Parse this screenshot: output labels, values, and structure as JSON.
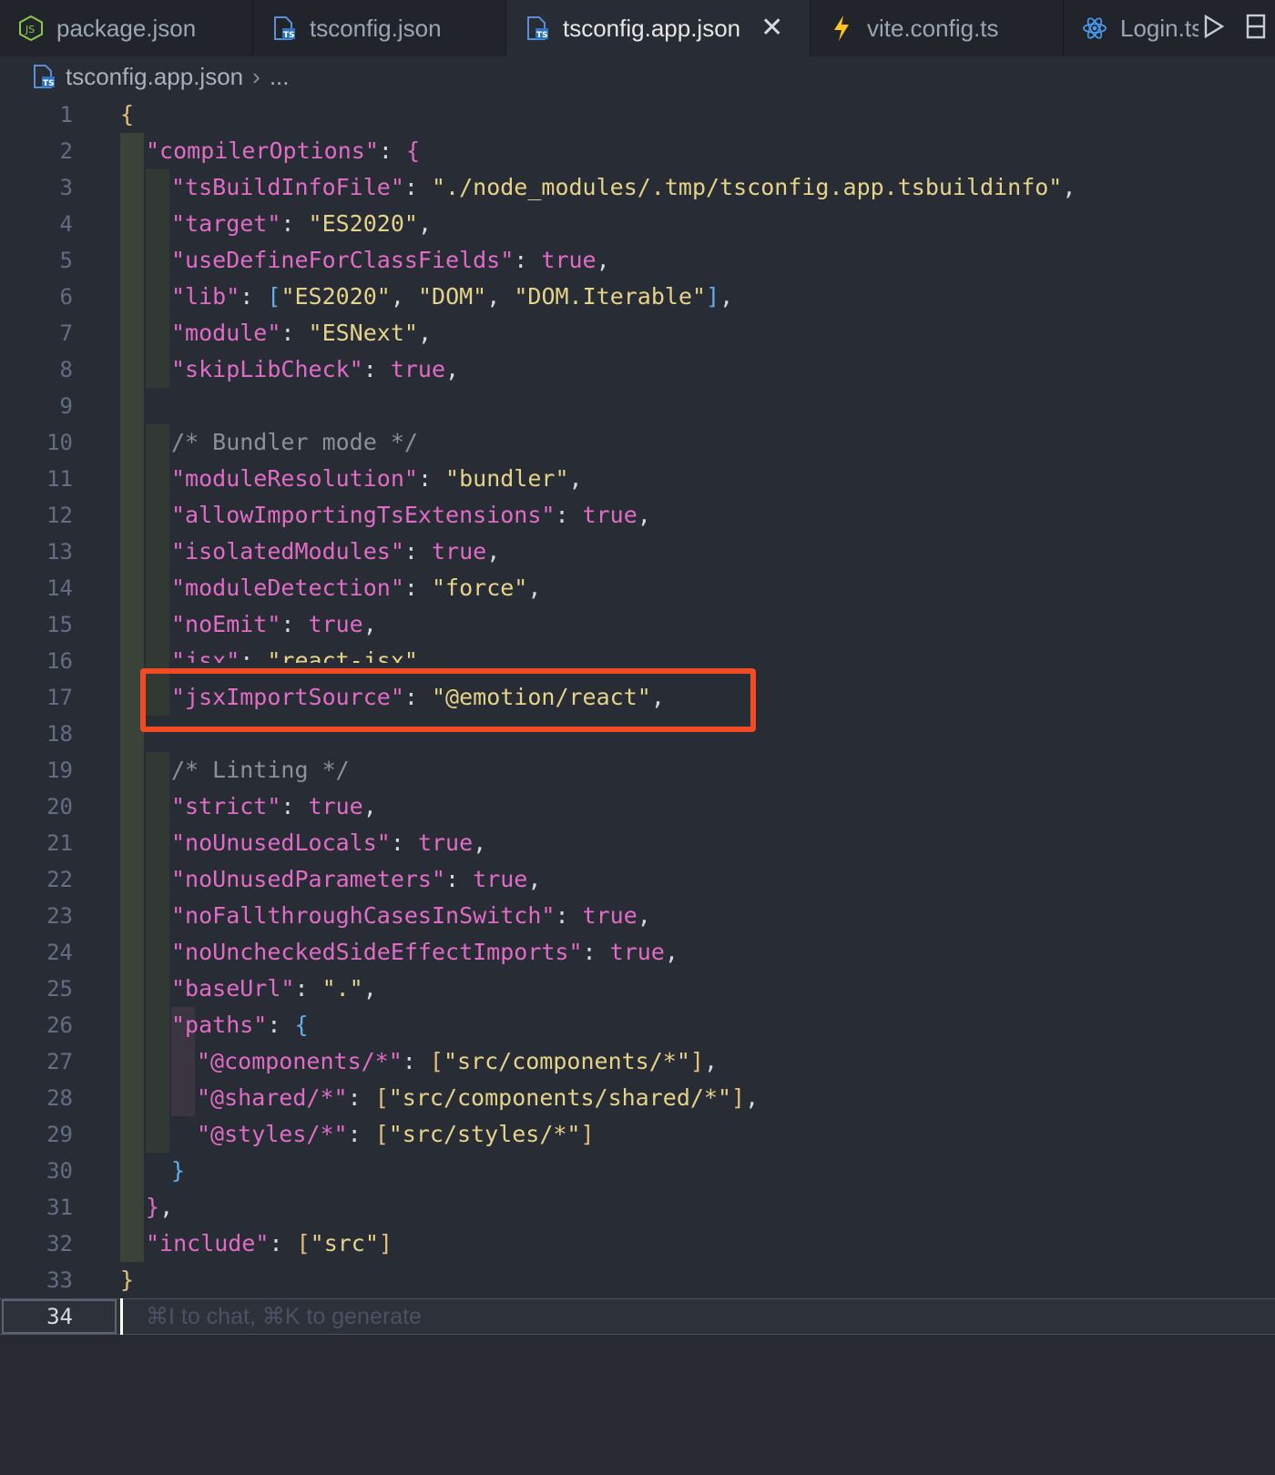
{
  "tabs": [
    {
      "label": "package.json",
      "icon": "nodejs-icon",
      "active": false
    },
    {
      "label": "tsconfig.json",
      "icon": "tsconfig-icon",
      "active": false
    },
    {
      "label": "tsconfig.app.json",
      "icon": "tsconfig-icon",
      "active": true
    },
    {
      "label": "vite.config.ts",
      "icon": "vite-icon",
      "active": false
    },
    {
      "label": "Login.ts",
      "icon": "react-icon",
      "active": false
    }
  ],
  "breadcrumb": {
    "file": "tsconfig.app.json",
    "rest": "..."
  },
  "editor": {
    "current_line": "34",
    "hint": "⌘I to chat, ⌘K to generate",
    "lines": [
      "1",
      "2",
      "3",
      "4",
      "5",
      "6",
      "7",
      "8",
      "9",
      "10",
      "11",
      "12",
      "13",
      "14",
      "15",
      "16",
      "17",
      "18",
      "19",
      "20",
      "21",
      "22",
      "23",
      "24",
      "25",
      "26",
      "27",
      "28",
      "29",
      "30",
      "31",
      "32",
      "33"
    ],
    "code": {
      "compilerOptions": "\"compilerOptions\"",
      "tsBuildInfoFile_k": "\"tsBuildInfoFile\"",
      "tsBuildInfoFile_v": "\"./node_modules/.tmp/tsconfig.app.tsbuildinfo\"",
      "target_k": "\"target\"",
      "target_v": "\"ES2020\"",
      "useDefine_k": "\"useDefineForClassFields\"",
      "true": "true",
      "lib_k": "\"lib\"",
      "lib_v1": "\"ES2020\"",
      "lib_v2": "\"DOM\"",
      "lib_v3": "\"DOM.Iterable\"",
      "module_k": "\"module\"",
      "module_v": "\"ESNext\"",
      "skipLib_k": "\"skipLibCheck\"",
      "comment_bundler": "/* Bundler mode */",
      "moduleRes_k": "\"moduleResolution\"",
      "moduleRes_v": "\"bundler\"",
      "allowTs_k": "\"allowImportingTsExtensions\"",
      "isolated_k": "\"isolatedModules\"",
      "moduleDet_k": "\"moduleDetection\"",
      "moduleDet_v": "\"force\"",
      "noEmit_k": "\"noEmit\"",
      "jsx_k": "\"jsx\"",
      "jsx_v": "\"react-jsx\"",
      "jsxImport_k": "\"jsxImportSource\"",
      "jsxImport_v": "\"@emotion/react\"",
      "comment_lint": "/* Linting */",
      "strict_k": "\"strict\"",
      "noUnusedLocals_k": "\"noUnusedLocals\"",
      "noUnusedParams_k": "\"noUnusedParameters\"",
      "noFallthrough_k": "\"noFallthroughCasesInSwitch\"",
      "noUnchecked_k": "\"noUncheckedSideEffectImports\"",
      "baseUrl_k": "\"baseUrl\"",
      "baseUrl_v": "\".\"",
      "paths_k": "\"paths\"",
      "comp_k": "\"@components/*\"",
      "comp_v": "\"src/components/*\"",
      "shared_k": "\"@shared/*\"",
      "shared_v": "\"src/components/shared/*\"",
      "styles_k": "\"@styles/*\"",
      "styles_v": "\"src/styles/*\"",
      "include_k": "\"include\"",
      "include_v": "\"src\""
    }
  },
  "colors": {
    "highlight_box": "#f04b24",
    "key": "#e06cc7",
    "string": "#e5d38a"
  }
}
